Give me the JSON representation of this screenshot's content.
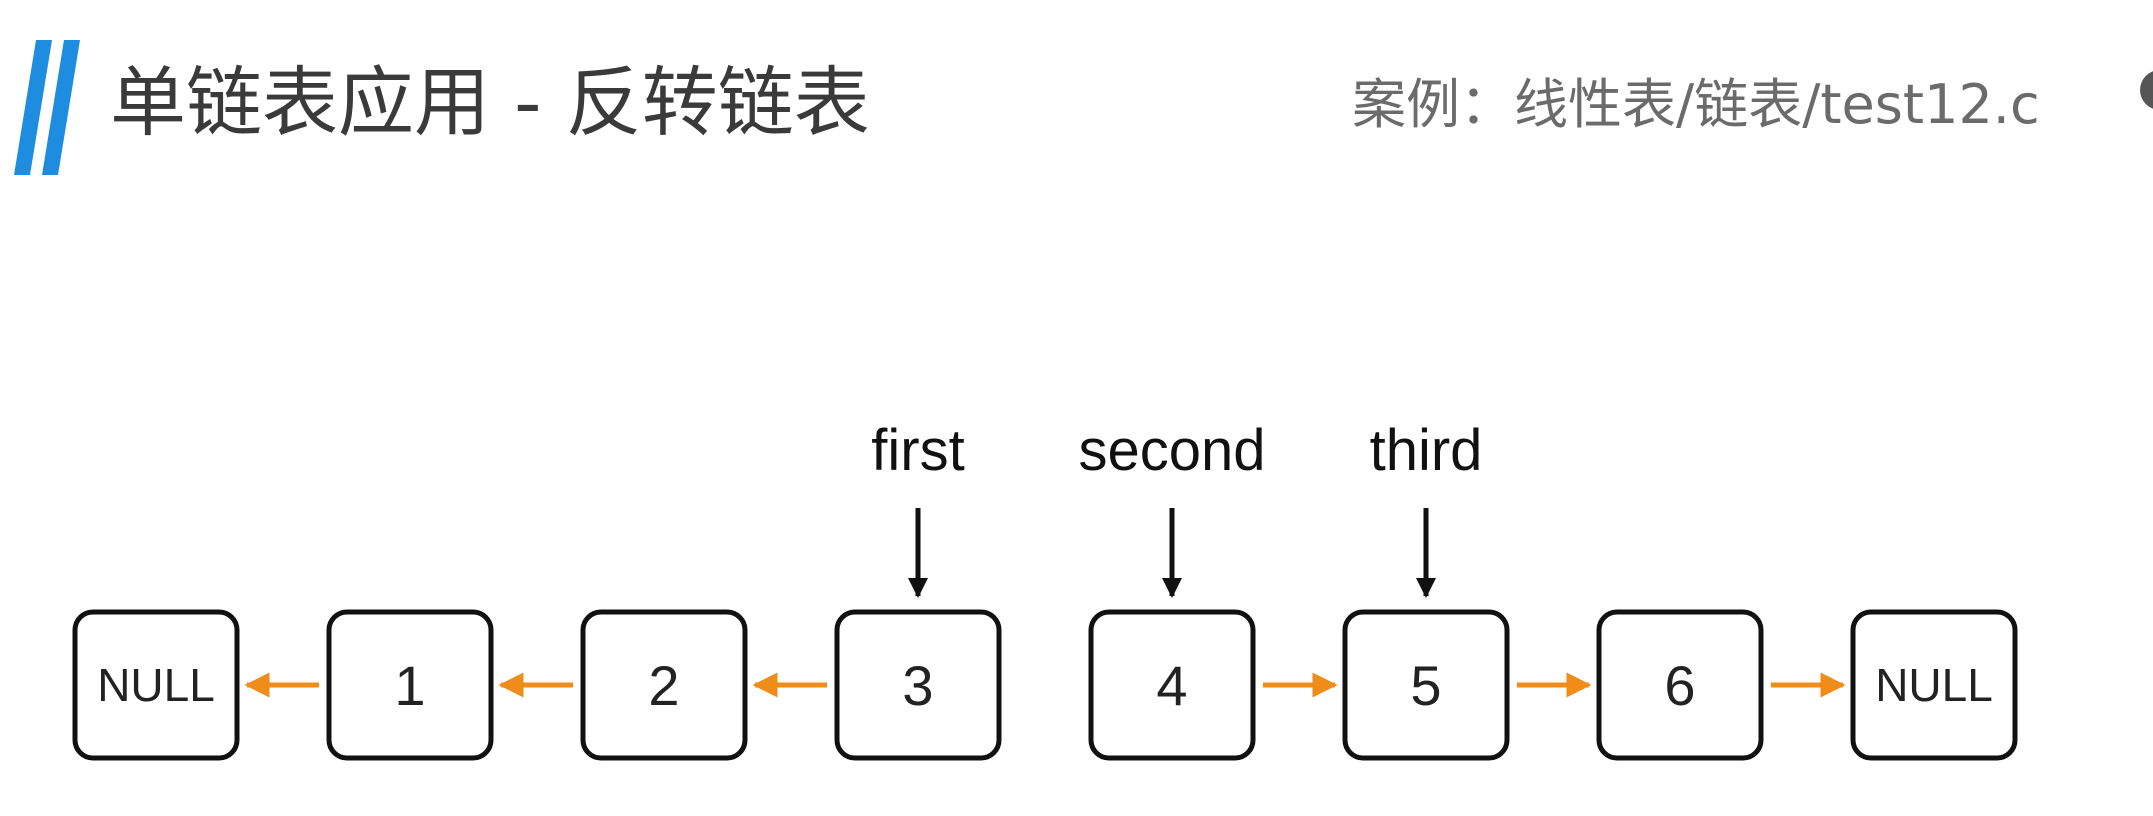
{
  "header": {
    "title": "单链表应用 - 反转链表",
    "case_label": "案例：线性表/链表/test12.c"
  },
  "diagram": {
    "nodes": [
      {
        "label": "NULL"
      },
      {
        "label": "1"
      },
      {
        "label": "2"
      },
      {
        "label": "3"
      },
      {
        "label": "4"
      },
      {
        "label": "5"
      },
      {
        "label": "6"
      },
      {
        "label": "NULL"
      }
    ],
    "links": [
      {
        "from": 1,
        "to": 0
      },
      {
        "from": 2,
        "to": 1
      },
      {
        "from": 3,
        "to": 2
      },
      {
        "from": 4,
        "to": 5
      },
      {
        "from": 5,
        "to": 6
      },
      {
        "from": 6,
        "to": 7
      }
    ],
    "pointers": [
      {
        "label": "first",
        "node": 3
      },
      {
        "label": "second",
        "node": 4
      },
      {
        "label": "third",
        "node": 5
      }
    ],
    "colors": {
      "accent_bars": "#1e8de0",
      "link_arrow": "#f08c1a",
      "pointer_arrow": "#111111",
      "node_border": "#111111"
    }
  }
}
